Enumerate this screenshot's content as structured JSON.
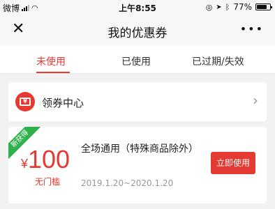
{
  "status_bar": {
    "carrier": "微博",
    "time": "上午8:55",
    "battery": "77%",
    "battery_level": 0.77
  },
  "nav": {
    "close_glyph": "✕",
    "title": "我的优惠券",
    "more_glyph": "•••"
  },
  "tabs": [
    {
      "label": "未使用",
      "active": true
    },
    {
      "label": "已使用",
      "active": false
    },
    {
      "label": "已过期/失效",
      "active": false
    }
  ],
  "coupon_center": {
    "icon": "coupon-ticket-icon",
    "icon_glyph": "¥",
    "label": "领券中心",
    "chevron": "›"
  },
  "coupon": {
    "badge": "新获得",
    "currency": "¥",
    "amount": "100",
    "threshold": "无门槛",
    "title": "全场通用（特殊商品除外）",
    "date_range": "2019.1.20~2020.1.20",
    "action_label": "立即使用",
    "accent_color": "#e53a31",
    "badge_color": "#2fb24d"
  }
}
